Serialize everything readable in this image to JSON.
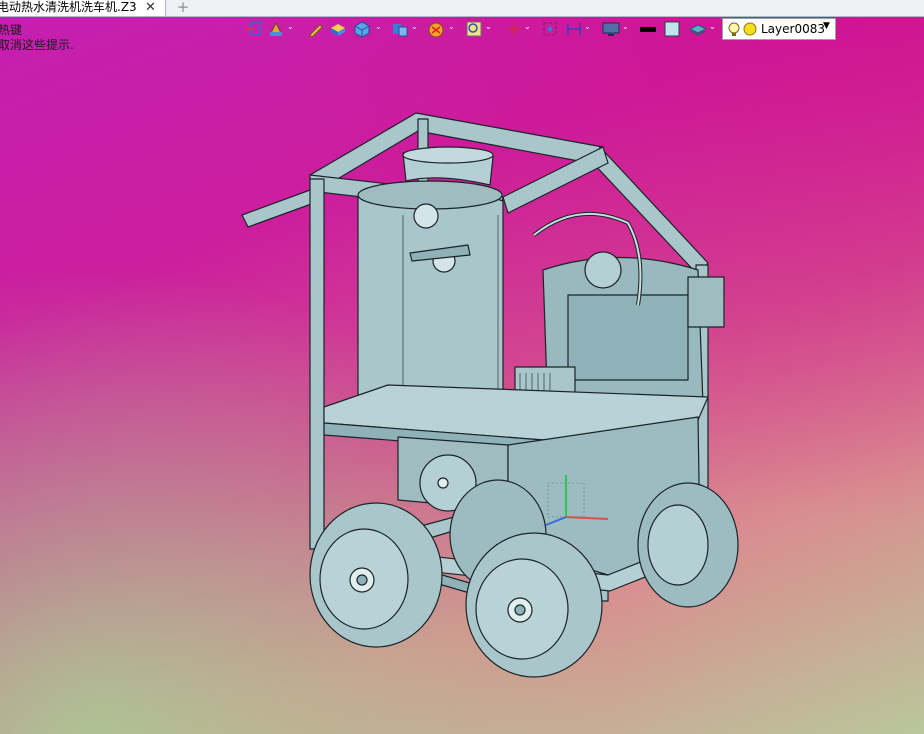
{
  "tab": {
    "title": "电动热水清洗机洗车机.Z3",
    "close_glyph": "✕",
    "new_tab_glyph": "+"
  },
  "hints": [
    "热键",
    "取消这些提示."
  ],
  "toolbar": {
    "icons": [
      "snap-icon",
      "render-style-icon",
      "pencil-icon",
      "solid-icon",
      "cube-view-icon",
      "display-icon",
      "filter-icon",
      "zoom-icon",
      "pick-icon",
      "component-icon",
      "dimension-icon",
      "monitor-icon",
      "line-color-icon",
      "fill-color-icon",
      "layer-stack-icon"
    ],
    "layer": {
      "name": "Layer0083",
      "bulb_color": "#f4d23b",
      "dot_color": "#f6dd1e"
    }
  },
  "colors": {
    "model_fill": "#a9c6cb",
    "model_stroke": "#1a2428",
    "model_shade": "#8fb2b8"
  }
}
